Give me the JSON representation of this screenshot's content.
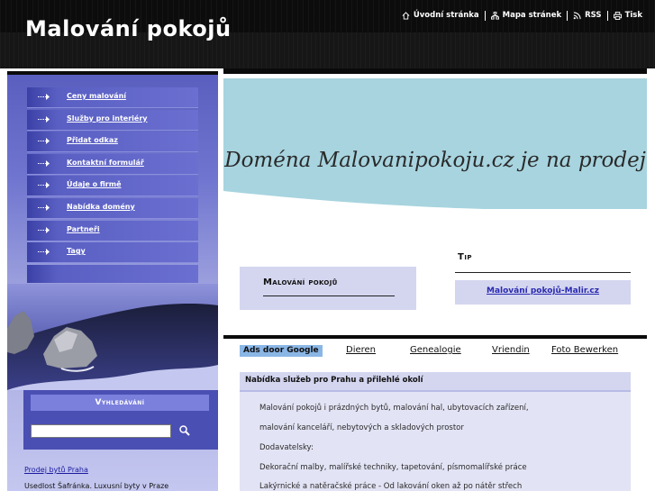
{
  "header": {
    "site_title": "Malování pokojů",
    "toplinks": [
      {
        "label": "Úvodní stránka",
        "icon": "home-icon"
      },
      {
        "label": "Mapa stránek",
        "icon": "sitemap-icon"
      },
      {
        "label": "RSS",
        "icon": "rss-icon"
      },
      {
        "label": "Tisk",
        "icon": "print-icon"
      }
    ]
  },
  "sidebar": {
    "nav": [
      {
        "label": "Ceny malování"
      },
      {
        "label": "Služby pro interiéry"
      },
      {
        "label": "Přidat odkaz"
      },
      {
        "label": "Kontaktní formulář"
      },
      {
        "label": "Údaje o firmě"
      },
      {
        "label": "Nabídka domény"
      },
      {
        "label": "Partneři"
      },
      {
        "label": "Tagy"
      }
    ],
    "search": {
      "title": "Vyhledávání",
      "input_value": "",
      "icon": "search-icon"
    },
    "promo": {
      "link": "Prodej bytů Praha",
      "text": "Usedlost Šafránka. Luxusní byty v Praze"
    }
  },
  "banner": {
    "text": "Doména Malovanipokoju.cz je na prodej"
  },
  "name_box": {
    "title": "Malování pokojů"
  },
  "tip": {
    "title": "Tip",
    "link": "Malování pokojů-Malir.cz"
  },
  "ads": {
    "label": "Ads door Google",
    "links": [
      "Dieren",
      "Genealogie",
      "Vriendin",
      "Foto Bewerken"
    ]
  },
  "services": {
    "heading": "Nabídka služeb pro Prahu a přilehlé okolí",
    "lines": [
      "Malování pokojů i prázdných bytů, malování hal, ubytovacích zařízení,",
      "malování kanceláří, nebytových a skladových prostor",
      "Dodavatelsky:",
      "Dekorační malby, malířské techniky, tapetování, písmomalířské práce",
      "Lakýrnické a natěračské práce - Od lakování oken až po nátěr střech"
    ]
  },
  "colors": {
    "header_bg": "#0c0c0c",
    "sidebar_accent": "#5a5fbf",
    "banner_bg": "#a7d4df",
    "box_bg": "#d4d6f0",
    "ads_label_bg": "#8ab6e6"
  }
}
